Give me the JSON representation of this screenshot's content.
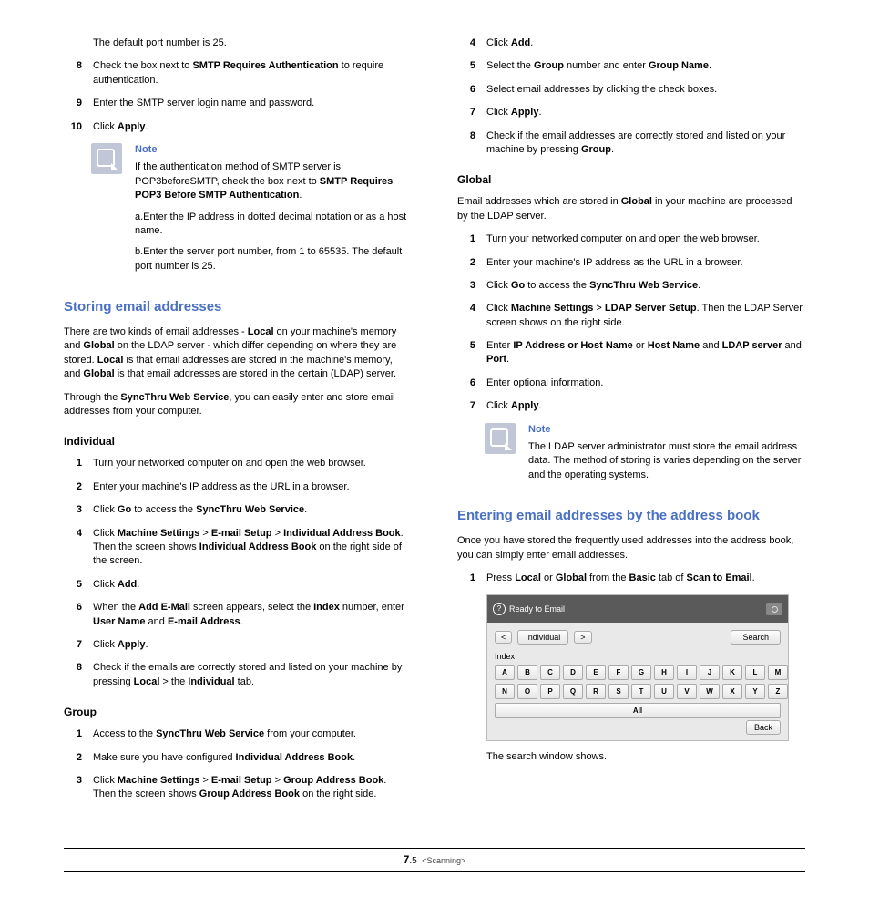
{
  "left": {
    "intro_para": "The default port number is 25.",
    "step8_num": "8",
    "step8_a": "Check the box next to ",
    "step8_b": "SMTP Requires Authentication",
    "step8_c": " to require authentication.",
    "step9_num": "9",
    "step9": "Enter the SMTP server login name and password.",
    "step10_num": "10",
    "step10_a": "Click ",
    "step10_b": "Apply",
    "step10_c": ".",
    "note_title": "Note",
    "note_p1_a": "If the authentication method of SMTP server is POP3beforeSMTP, check the box next to ",
    "note_p1_b": "SMTP Requires POP3 Before SMTP Authentication",
    "note_p1_c": ".",
    "note_a": "a.Enter the IP address in dotted decimal notation or as a host name.",
    "note_b": "b.Enter the server port number, from 1 to 65535. The default port number is 25.",
    "h2a": "Storing email addresses",
    "storing_p1_a": "There are two kinds of email addresses - ",
    "storing_p1_b": "Local",
    "storing_p1_c": " on your machine's memory and ",
    "storing_p1_d": "Global",
    "storing_p1_e": " on the LDAP server - which differ depending on where they are stored. ",
    "storing_p1_f": "Local",
    "storing_p1_g": " is that email addresses are stored in the machine's memory, and ",
    "storing_p1_h": "Global",
    "storing_p1_i": " is that email addresses are stored in the certain (LDAP) server.",
    "storing_p2_a": "Through the ",
    "storing_p2_b": "SyncThru Web Service",
    "storing_p2_c": ", you can easily enter and store email addresses from your computer.",
    "h3_individual": "Individual",
    "ind": {
      "n1": "1",
      "s1": "Turn your networked computer on and open the web browser.",
      "n2": "2",
      "s2": "Enter your machine's IP address as the URL in a browser.",
      "n3": "3",
      "s3a": "Click ",
      "s3b": "Go",
      "s3c": " to access the ",
      "s3d": "SyncThru Web Service",
      "s3e": ".",
      "n4": "4",
      "s4a": "Click ",
      "s4b": "Machine Settings",
      "s4c": " > ",
      "s4d": "E-mail Setup",
      "s4e": " > ",
      "s4f": "Individual Address Book",
      "s4g": ". Then the screen shows ",
      "s4h": "Individual Address Book",
      "s4i": " on the right side of the screen.",
      "n5": "5",
      "s5a": "Click ",
      "s5b": "Add",
      "s5c": ".",
      "n6": "6",
      "s6a": "When the ",
      "s6b": "Add E-Mail",
      "s6c": " screen appears, select the ",
      "s6d": "Index",
      "s6e": " number, enter ",
      "s6f": "User Name",
      "s6g": " and ",
      "s6h": "E-mail Address",
      "s6i": ".",
      "n7": "7",
      "s7a": "Click ",
      "s7b": "Apply",
      "s7c": ".",
      "n8": "8",
      "s8a": "Check if the emails are correctly stored and listed on your machine by pressing ",
      "s8b": "Local",
      "s8c": " > the ",
      "s8d": "Individual",
      "s8e": " tab."
    },
    "h3_group": "Group",
    "grp": {
      "n1": "1",
      "s1a": "Access to the ",
      "s1b": "SyncThru Web Service",
      "s1c": " from your computer.",
      "n2": "2",
      "s2a": "Make sure you have configured ",
      "s2b": "Individual Address Book",
      "s2c": ".",
      "n3": "3",
      "s3a": "Click ",
      "s3b": "Machine Settings",
      "s3c": " > ",
      "s3d": "E-mail Setup",
      "s3e": " > ",
      "s3f": "Group Address Book",
      "s3g": ". Then the screen shows ",
      "s3h": "Group Address Book",
      "s3i": " on the right side."
    }
  },
  "right": {
    "cont": {
      "n4": "4",
      "s4a": "Click ",
      "s4b": "Add",
      "s4c": ".",
      "n5": "5",
      "s5a": "Select the ",
      "s5b": "Group",
      "s5c": " number and enter ",
      "s5d": "Group Name",
      "s5e": ".",
      "n6": "6",
      "s6": "Select email addresses by clicking the check boxes.",
      "n7": "7",
      "s7a": "Click ",
      "s7b": "Apply",
      "s7c": ".",
      "n8": "8",
      "s8a": "Check if the email addresses are correctly stored and listed on your machine by pressing ",
      "s8b": "Group",
      "s8c": "."
    },
    "h3_global": "Global",
    "global_intro_a": "Email addresses which are stored in ",
    "global_intro_b": "Global",
    "global_intro_c": " in your machine are processed by the LDAP server.",
    "glo": {
      "n1": "1",
      "s1": "Turn your networked computer on and open the web browser.",
      "n2": "2",
      "s2": "Enter your machine's IP address as the URL in a browser.",
      "n3": "3",
      "s3a": "Click ",
      "s3b": "Go",
      "s3c": " to access the ",
      "s3d": "SyncThru Web Service",
      "s3e": ".",
      "n4": "4",
      "s4a": "Click ",
      "s4b": "Machine Settings",
      "s4c": " > ",
      "s4d": "LDAP Server Setup",
      "s4e": ". Then the LDAP Server screen shows on the right side.",
      "n5": "5",
      "s5a": "Enter ",
      "s5b": "IP Address or Host Name",
      "s5c": " or ",
      "s5d": "Host Name",
      "s5e": " and ",
      "s5f": "LDAP server",
      "s5g": " and ",
      "s5h": "Port",
      "s5i": ".",
      "n6": "6",
      "s6": "Enter optional information.",
      "n7": "7",
      "s7a": "Click ",
      "s7b": "Apply",
      "s7c": "."
    },
    "note2_title": "Note",
    "note2_text": "The LDAP server administrator must store the email address data. The method of storing is varies depending on the server and the operating systems.",
    "h2b": "Entering email addresses by the address book",
    "enter_intro": "Once you have stored the frequently used addresses into the address book, you can simply enter email addresses.",
    "ent": {
      "n1": "1",
      "s1a": "Press ",
      "s1b": "Local",
      "s1c": " or ",
      "s1d": "Global",
      "s1e": " from the ",
      "s1f": "Basic",
      "s1g": " tab of ",
      "s1h": "Scan to Email",
      "s1i": "."
    },
    "shot": {
      "title": "Ready to Email",
      "individual": "Individual",
      "search": "Search",
      "index": "Index",
      "keys1": [
        "A",
        "B",
        "C",
        "D",
        "E",
        "F",
        "G",
        "H",
        "I",
        "J",
        "K",
        "L",
        "M"
      ],
      "keys2": [
        "N",
        "O",
        "P",
        "Q",
        "R",
        "S",
        "T",
        "U",
        "V",
        "W",
        "X",
        "Y",
        "Z"
      ],
      "all": "All",
      "back": "Back"
    },
    "after_shot": "The search window shows."
  },
  "footer": {
    "page": "7",
    "sub": ".5",
    "section": "<Scanning>"
  }
}
